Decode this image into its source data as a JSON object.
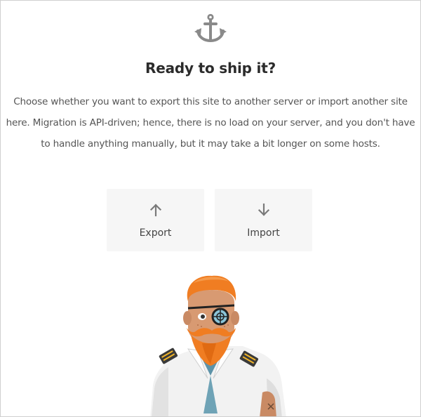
{
  "header": {
    "icon": "anchor-icon",
    "title": "Ready to ship it?"
  },
  "description": "Choose whether you want to export this site to another server or import another site here. Migration is API-driven; hence, there is no load on your server, and you don't have to handle anything manually, but it may take a bit longer on some hosts.",
  "actions": [
    {
      "label": "Export",
      "icon": "arrow-up-icon"
    },
    {
      "label": "Import",
      "icon": "arrow-down-icon"
    }
  ],
  "illustration": "captain-mascot",
  "colors": {
    "icon": "#8a8a8a",
    "card_bg": "#f6f6f6",
    "title": "#2b2b2b",
    "text": "#555555",
    "beard": "#f07d22"
  }
}
